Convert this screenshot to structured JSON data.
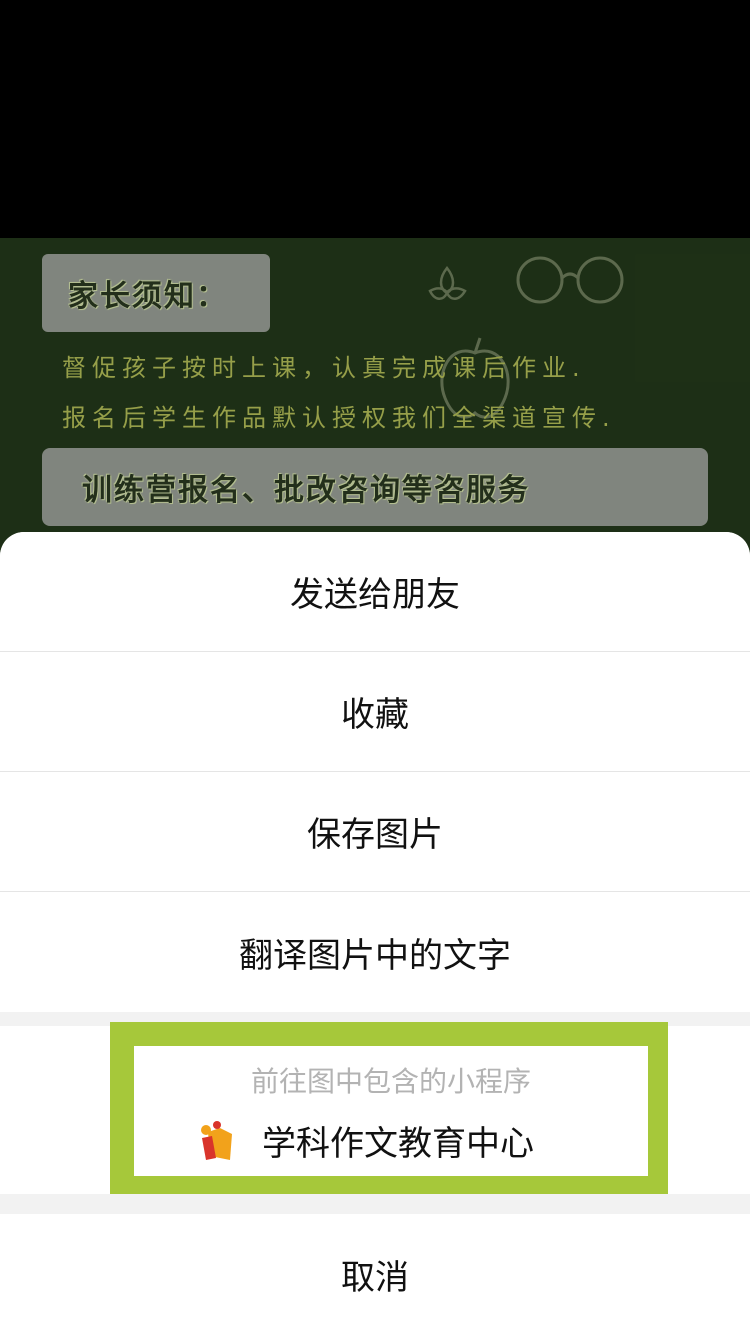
{
  "poster": {
    "notice_title": "家长须知：",
    "line1": "督促孩子按时上课，认真完成课后作业.",
    "line2": "报名后学生作品默认授权我们全渠道宣传.",
    "service": "训练营报名、批改咨询等咨服务",
    "colors": {
      "board": "#243a1b",
      "box": "#9da39a",
      "text": "#b7c25a"
    }
  },
  "action_sheet": {
    "items": [
      "发送给朋友",
      "收藏",
      "保存图片",
      "翻译图片中的文字"
    ],
    "mini_program": {
      "caption": "前往图中包含的小程序",
      "name": "学科作文教育中心",
      "highlight_color": "#a6c83a"
    },
    "cancel": "取消"
  }
}
